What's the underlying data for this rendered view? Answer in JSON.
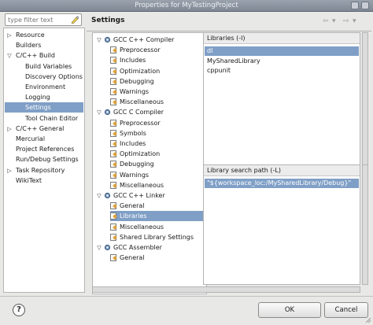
{
  "window": {
    "title": "Properties for MyTestingProject"
  },
  "filter": {
    "placeholder": "type filter text"
  },
  "left_tree": [
    {
      "label": "Resource",
      "arrow": "▷",
      "depth": 0
    },
    {
      "label": "Builders",
      "arrow": "",
      "depth": 0
    },
    {
      "label": "C/C++ Build",
      "arrow": "▽",
      "depth": 0
    },
    {
      "label": "Build Variables",
      "arrow": "",
      "depth": 1
    },
    {
      "label": "Discovery Options",
      "arrow": "",
      "depth": 1
    },
    {
      "label": "Environment",
      "arrow": "",
      "depth": 1
    },
    {
      "label": "Logging",
      "arrow": "",
      "depth": 1
    },
    {
      "label": "Settings",
      "arrow": "",
      "depth": 1,
      "selected": true
    },
    {
      "label": "Tool Chain Editor",
      "arrow": "",
      "depth": 1
    },
    {
      "label": "C/C++ General",
      "arrow": "▷",
      "depth": 0
    },
    {
      "label": "Mercurial",
      "arrow": "",
      "depth": 0
    },
    {
      "label": "Project References",
      "arrow": "",
      "depth": 0
    },
    {
      "label": "Run/Debug Settings",
      "arrow": "",
      "depth": 0
    },
    {
      "label": "Task Repository",
      "arrow": "▷",
      "depth": 0
    },
    {
      "label": "WikiText",
      "arrow": "",
      "depth": 0
    }
  ],
  "settings": {
    "title": "Settings",
    "nav": {
      "back": "⇦",
      "forward": "⇨",
      "menu": "▾"
    }
  },
  "tool_tree": [
    {
      "label": "GCC C++ Compiler",
      "group": true
    },
    {
      "label": "Preprocessor"
    },
    {
      "label": "Includes"
    },
    {
      "label": "Optimization"
    },
    {
      "label": "Debugging"
    },
    {
      "label": "Warnings"
    },
    {
      "label": "Miscellaneous"
    },
    {
      "label": "GCC C Compiler",
      "group": true
    },
    {
      "label": "Preprocessor"
    },
    {
      "label": "Symbols"
    },
    {
      "label": "Includes"
    },
    {
      "label": "Optimization"
    },
    {
      "label": "Debugging"
    },
    {
      "label": "Warnings"
    },
    {
      "label": "Miscellaneous"
    },
    {
      "label": "GCC C++ Linker",
      "group": true
    },
    {
      "label": "General"
    },
    {
      "label": "Libraries",
      "selected": true
    },
    {
      "label": "Miscellaneous"
    },
    {
      "label": "Shared Library Settings"
    },
    {
      "label": "GCC Assembler",
      "group": true
    },
    {
      "label": "General"
    }
  ],
  "libraries_panel": {
    "title": "Libraries (-l)",
    "items": [
      "dl",
      "MySharedLibrary",
      "cppunit"
    ],
    "selected_index": 0
  },
  "search_path_panel": {
    "title": "Library search path (-L)",
    "items": [
      "\"${workspace_loc:/MySharedLibrary/Debug}\""
    ],
    "selected_index": 0
  },
  "buttons": {
    "help": "?",
    "ok": "OK",
    "cancel": "Cancel"
  },
  "colors": {
    "selection": "#7f9fc6",
    "titlebar": "#8b939e"
  }
}
